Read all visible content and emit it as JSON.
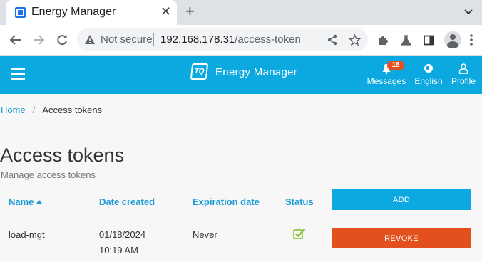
{
  "browser": {
    "tab_title": "Energy Manager",
    "tab_close": "✕",
    "new_tab": "+",
    "security_label": "Not secure",
    "url_host": "192.168.178.31",
    "url_path": "/access-token"
  },
  "header": {
    "brand": "Energy Manager",
    "logo_text": "TQ",
    "messages_label": "Messages",
    "messages_count": "18",
    "language_label": "English",
    "profile_label": "Profile"
  },
  "breadcrumb": {
    "home": "Home",
    "separator": "/",
    "current": "Access tokens"
  },
  "page": {
    "title": "Access tokens",
    "subtitle": "Manage access tokens"
  },
  "table": {
    "columns": {
      "name": "Name",
      "date_created": "Date created",
      "expiration_date": "Expiration date",
      "status": "Status"
    },
    "add_button": "ADD",
    "rows": [
      {
        "name": "load-mgt",
        "date": "01/18/2024",
        "time": "10:19 AM",
        "expiration": "Never",
        "status": "active",
        "revoke_button": "REVOKE"
      }
    ]
  },
  "colors": {
    "accent": "#0ca8e0",
    "danger": "#e2511d",
    "success": "#8cc63f"
  }
}
